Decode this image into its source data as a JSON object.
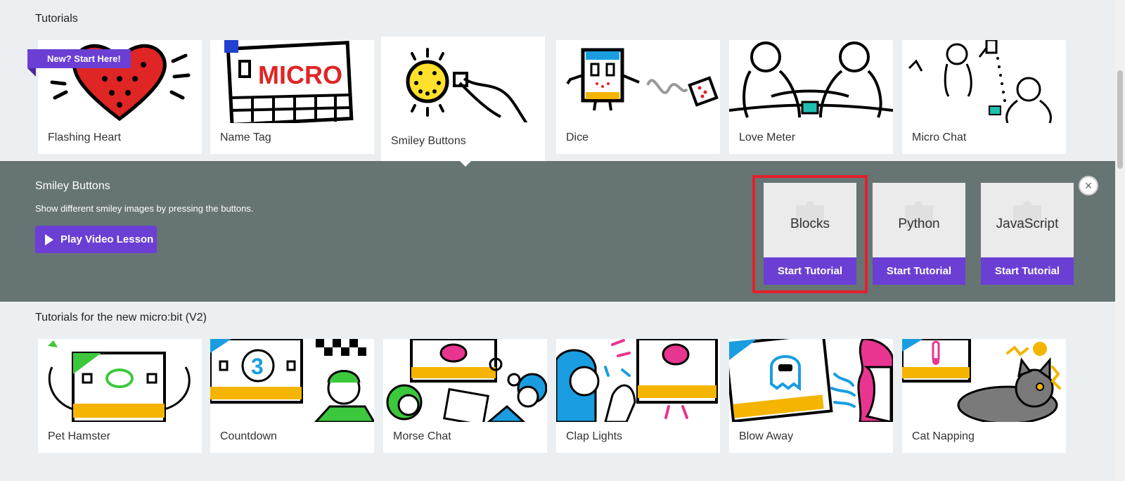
{
  "sections": {
    "tutorials_title": "Tutorials",
    "v2_title": "Tutorials for the new micro:bit (V2)"
  },
  "badge": "New? Start Here!",
  "tutorials": [
    {
      "label": "Flashing Heart",
      "icon": "heart-icon"
    },
    {
      "label": "Name Tag",
      "icon": "name-tag-icon"
    },
    {
      "label": "Smiley Buttons",
      "icon": "smiley-icon"
    },
    {
      "label": "Dice",
      "icon": "dice-icon"
    },
    {
      "label": "Love Meter",
      "icon": "love-meter-icon"
    },
    {
      "label": "Micro Chat",
      "icon": "chat-icon"
    }
  ],
  "detail": {
    "title": "Smiley Buttons",
    "description": "Show different smiley images by pressing the buttons.",
    "play_label": "Play Video Lesson",
    "languages": [
      {
        "name": "Blocks",
        "action": "Start Tutorial"
      },
      {
        "name": "Python",
        "action": "Start Tutorial"
      },
      {
        "name": "JavaScript",
        "action": "Start Tutorial"
      }
    ],
    "close_symbol": "×"
  },
  "v2_tutorials": [
    {
      "label": "Pet Hamster"
    },
    {
      "label": "Countdown"
    },
    {
      "label": "Morse Chat"
    },
    {
      "label": "Clap Lights"
    },
    {
      "label": "Blow Away"
    },
    {
      "label": "Cat Napping"
    }
  ],
  "colors": {
    "accent": "#6b3fd4",
    "panel": "#667474",
    "highlight": "#e3202a"
  }
}
